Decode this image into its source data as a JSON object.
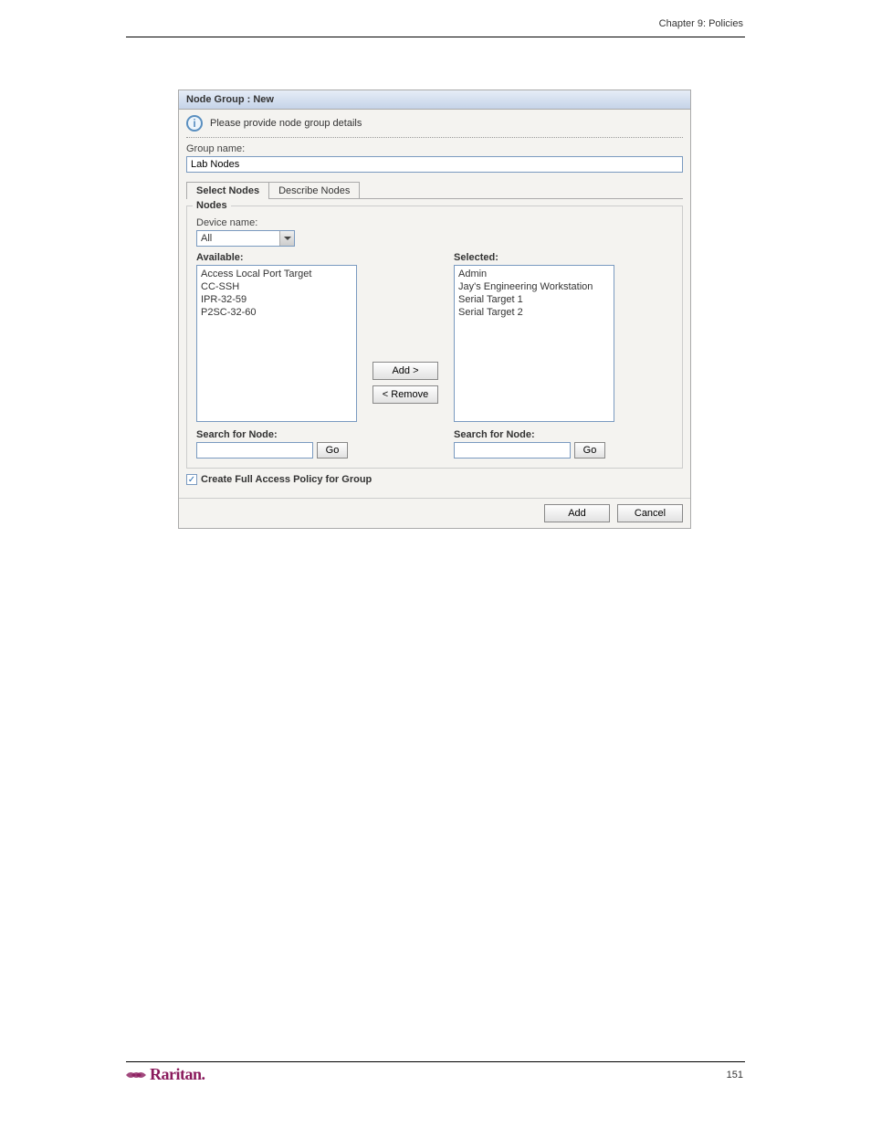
{
  "page": {
    "chapter_header": "Chapter 9: Policies",
    "page_number": "151",
    "logo_text": "Raritan."
  },
  "panel": {
    "title": "Node Group : New",
    "info_message": "Please provide node group details",
    "group_name_label": "Group name:",
    "group_name_value": "Lab Nodes"
  },
  "tabs": {
    "select": "Select Nodes",
    "describe": "Describe Nodes"
  },
  "nodes": {
    "fieldset_legend": "Nodes",
    "device_name_label": "Device name:",
    "device_name_value": "All",
    "available_label": "Available:",
    "selected_label": "Selected:",
    "available_items": [
      "Access Local Port Target",
      "CC-SSH",
      "IPR-32-59",
      "P2SC-32-60"
    ],
    "selected_items": [
      "Admin",
      "Jay's Engineering Workstation",
      "Serial Target 1",
      "Serial Target 2"
    ],
    "add_btn": "Add  >",
    "remove_btn": "<  Remove",
    "search_label": "Search for Node:",
    "go_btn": "Go"
  },
  "checkbox": {
    "label": "Create Full Access Policy for Group"
  },
  "footer": {
    "add_btn": "Add",
    "cancel_btn": "Cancel"
  }
}
